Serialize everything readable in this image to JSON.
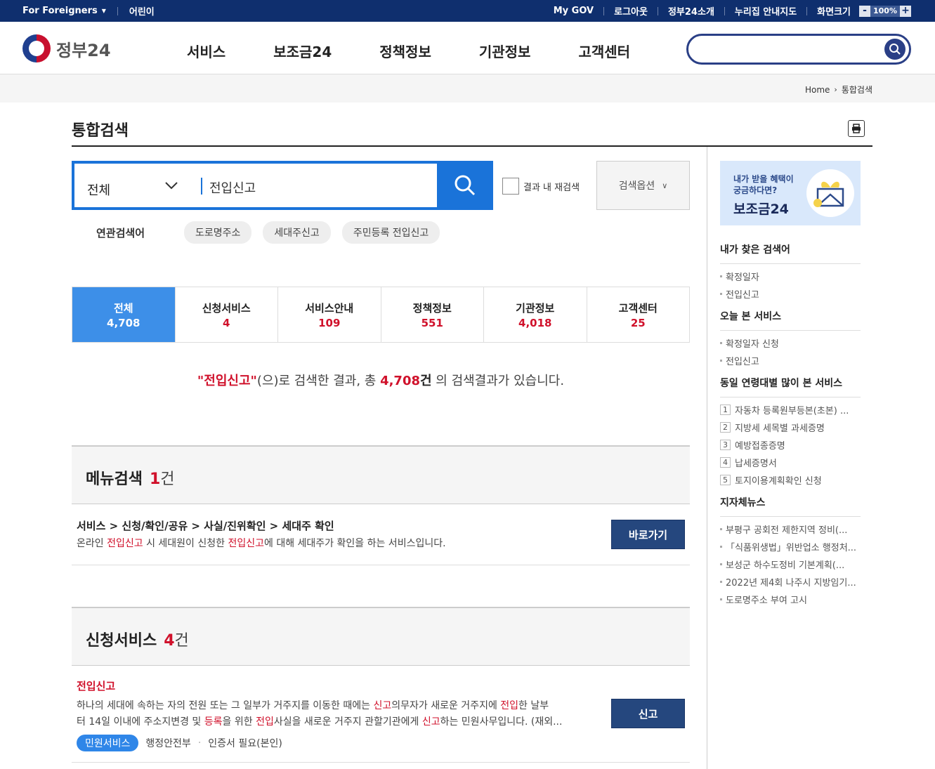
{
  "topbar": {
    "foreigners": "For Foreigners",
    "kids": "어린이",
    "mygov": "My GOV",
    "logout": "로그아웃",
    "intro": "정부24소개",
    "sitemap": "누리집 안내지도",
    "screen_size": "화면크기",
    "zoom_minus": "-",
    "zoom_value": "100%",
    "zoom_plus": "+"
  },
  "header": {
    "logo": "정부24",
    "nav": [
      "서비스",
      "보조금24",
      "정책정보",
      "기관정보",
      "고객센터"
    ],
    "search_placeholder": ""
  },
  "breadcrumb": {
    "home": "Home",
    "current": "통합검색"
  },
  "page": {
    "title": "통합검색"
  },
  "search": {
    "category": "전체",
    "query": "전입신고",
    "recheck_label": "결과 내 재검색",
    "options_label": "검색옵션",
    "related_label": "연관검색어",
    "related": [
      "도로명주소",
      "세대주신고",
      "주민등록 전입신고"
    ]
  },
  "tabs": [
    {
      "label": "전체",
      "count": "4,708"
    },
    {
      "label": "신청서비스",
      "count": "4"
    },
    {
      "label": "서비스안내",
      "count": "109"
    },
    {
      "label": "정책정보",
      "count": "551"
    },
    {
      "label": "기관정보",
      "count": "4,018"
    },
    {
      "label": "고객센터",
      "count": "25"
    }
  ],
  "summary": {
    "kw": "\"전입신고\"",
    "t1": "(으)로 검색한 결과, 총 ",
    "num": "4,708",
    "gun": "건",
    "t2": " 의 검색결과가 있습니다."
  },
  "menu_section": {
    "title": "메뉴검색",
    "count": "1",
    "unit": "건"
  },
  "menu_item": {
    "path": "서비스 > 신청/확인/공유 > 사실/진위확인 > 세대주 확인",
    "d1": "온라인 ",
    "d2": "전입신고",
    "d3": " 시 세대원이 신청한 ",
    "d4": "전입신고",
    "d5": "에 대해 세대주가 확인을 하는 서비스입니다.",
    "button": "바로가기"
  },
  "apply_section": {
    "title": "신청서비스",
    "count": "4",
    "unit": "건"
  },
  "apply_item": {
    "title": "전입신고",
    "l1a": "하나의 세대에 속하는 자의 전원 또는 그 일부가 거주지를 이동한 때에는 ",
    "l1b": "신고",
    "l1c": "의무자가 새로운 거주지에 ",
    "l1d": "전입",
    "l1e": "한 날부",
    "l2a": "터 14일 이내에 주소지변경 및 ",
    "l2b": "등록",
    "l2c": "을 위한 ",
    "l2d": "전입",
    "l2e": "사실을 새로운 거주지 관할기관에게 ",
    "l2f": "신고",
    "l2g": "하는 민원사무입니다. (재외...",
    "badge": "민원서비스",
    "org": "행정안전부",
    "dot": "·",
    "cert": "인증서 필요(본인)",
    "button": "신고"
  },
  "side": {
    "banner": {
      "line1": "내가 받을 혜택이",
      "line2": "궁금하다면?",
      "big": "보조금24"
    },
    "my_keywords": {
      "title": "내가 찾은 검색어",
      "items": [
        "확정일자",
        "전입신고"
      ]
    },
    "today_services": {
      "title": "오늘 본 서비스",
      "items": [
        "확정일자 신청",
        "전입신고"
      ]
    },
    "age_services": {
      "title": "동일 연령대별 많이 본 서비스",
      "items": [
        {
          "n": "1",
          "t": "자동차 등록원부등본(초본) ..."
        },
        {
          "n": "2",
          "t": "지방세 세목별 과세증명"
        },
        {
          "n": "3",
          "t": "예방접종증명"
        },
        {
          "n": "4",
          "t": "납세증명서"
        },
        {
          "n": "5",
          "t": "토지이용계획확인 신청"
        }
      ]
    },
    "local_news": {
      "title": "지자체뉴스",
      "items": [
        "부평구 공회전 제한지역 정비(...",
        "「식품위생법」위반업소 행정처...",
        "보성군 하수도정비 기본계획(...",
        "2022년 제4회 나주시 지방임기...",
        "도로명주소 부여 고시"
      ]
    }
  },
  "colors": {
    "navy": "#0f2f6e",
    "accent": "#1a73d9",
    "red": "#d0112b",
    "button": "#25477e"
  }
}
